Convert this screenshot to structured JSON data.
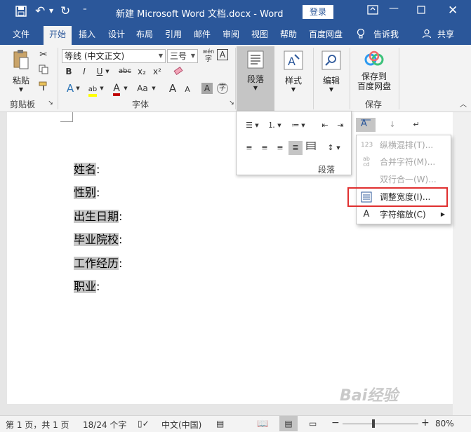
{
  "window": {
    "title": "新建 Microsoft Word 文档.docx - Word",
    "login_label": "登录"
  },
  "tabs": [
    "文件",
    "开始",
    "插入",
    "设计",
    "布局",
    "引用",
    "邮件",
    "审阅",
    "视图",
    "帮助",
    "百度网盘"
  ],
  "tell_me": "告诉我",
  "share": "共享",
  "ribbon": {
    "clipboard": {
      "paste": "粘贴",
      "label": "剪贴板"
    },
    "font": {
      "font_name": "等线 (中文正文)",
      "font_size": "三号",
      "phonetic": "wén",
      "label": "字体",
      "bold": "B",
      "italic": "I",
      "underline": "U",
      "strike": "abc",
      "subscript": "x₂",
      "superscript": "x²",
      "text_effect": "A",
      "highlight": "ab",
      "font_color": "A",
      "change_case": "Aa",
      "grow": "A",
      "shrink": "A",
      "char_shading": "A",
      "enclose": "字"
    },
    "paragraph": {
      "label": "段落"
    },
    "styles": {
      "label": "样式"
    },
    "editing": {
      "label": "编辑"
    },
    "save": {
      "label_line1": "保存到",
      "label_line2": "百度网盘",
      "group": "保存"
    }
  },
  "paragraph_panel": {
    "label": "段落"
  },
  "menu": {
    "items": [
      {
        "label": "纵横混排(T)...",
        "disabled": true,
        "icon": "vertical-horizontal-icon",
        "icon_text": "123"
      },
      {
        "label": "合并字符(M)...",
        "disabled": true,
        "icon": "combine-chars-icon",
        "icon_text": "ab cd"
      },
      {
        "label": "双行合一(W)...",
        "disabled": true,
        "icon": "two-lines-icon",
        "icon_text": ""
      },
      {
        "label": "调整宽度(I)...",
        "disabled": false,
        "icon": "adjust-width-icon",
        "icon_text": ""
      },
      {
        "label": "字符缩放(C)",
        "disabled": false,
        "icon": "char-scale-icon",
        "icon_text": "A",
        "submenu": true
      }
    ]
  },
  "document": {
    "lines": [
      "姓名",
      "性别",
      "出生日期",
      "毕业院校",
      "工作经历",
      "职业"
    ],
    "colon": ":"
  },
  "status": {
    "page": "第 1 页，共 1 页",
    "words": "18/24 个字",
    "language": "中文(中国)",
    "zoom": "80%"
  },
  "watermark": "Bai经验"
}
